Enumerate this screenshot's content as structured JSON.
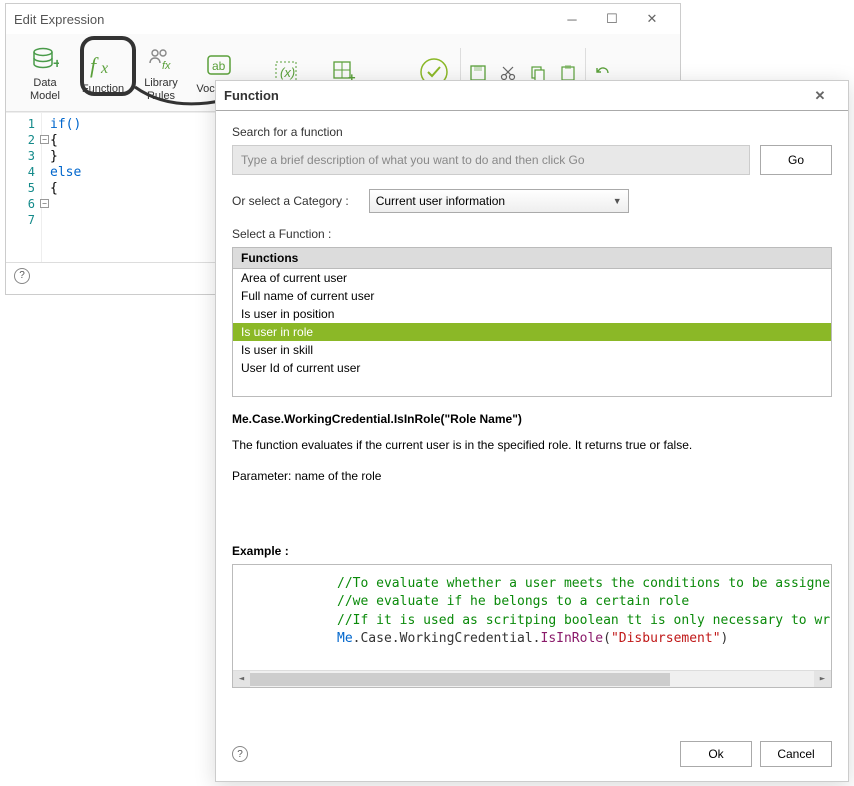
{
  "main_window": {
    "title": "Edit Expression",
    "toolbar": [
      {
        "label": "Data\nModel",
        "icon": "database-icon"
      },
      {
        "label": "Function",
        "icon": "fx-icon"
      },
      {
        "label": "Library\nRules",
        "icon": "people-fx-icon"
      },
      {
        "label": "Vocabula",
        "icon": "ab-icon"
      }
    ],
    "code_lines": [
      "if()",
      "{",
      "",
      "}",
      "else",
      "{",
      ""
    ]
  },
  "dialog": {
    "title": "Function",
    "search_label": "Search for a function",
    "search_placeholder": "Type a brief description of what you want to do and then click Go",
    "go_label": "Go",
    "category_label": "Or select a Category :",
    "category_value": "Current user information",
    "select_label": "Select a Function :",
    "functions_header": "Functions",
    "functions": [
      "Area of current user",
      "Full name of current user",
      "Is user in position",
      "Is user in role",
      "Is user in skill",
      "User Id of current user"
    ],
    "selected_index": 3,
    "signature": "Me.Case.WorkingCredential.IsInRole(\"Role Name\")",
    "description": "The function evaluates if the current user is in the specified role. It returns true or false.",
    "parameter": "Parameter: name of the role",
    "example_label": "Example :",
    "example": {
      "comment1": "//To evaluate whether a user meets the conditions to be assigne",
      "comment2": "//we evaluate if he belongs to a certain role",
      "comment3": "//If it is used as scritping boolean tt is only necessary to wr",
      "code_obj": "Me",
      "code_chain": ".Case.WorkingCredential.",
      "code_method": "IsInRole",
      "code_arg": "\"Disbursement\""
    },
    "ok_label": "Ok",
    "cancel_label": "Cancel"
  }
}
